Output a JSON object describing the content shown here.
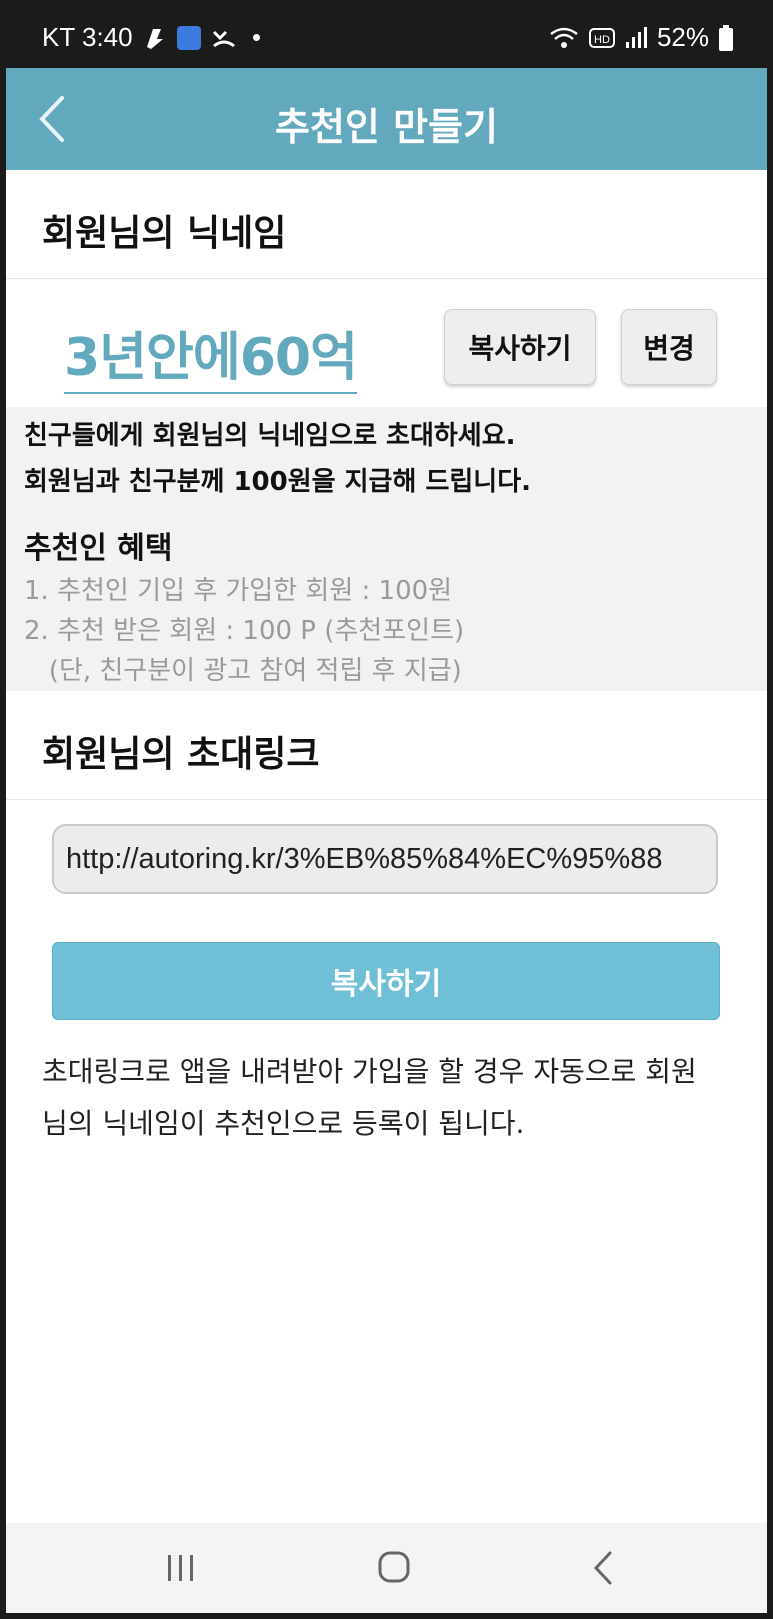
{
  "status_bar": {
    "carrier_time": "KT 3:40",
    "battery": "52%",
    "icons": [
      "notification-icon",
      "app-icon",
      "missed-call-icon",
      "wifi-icon",
      "hd-icon",
      "signal-icon",
      "battery-icon"
    ]
  },
  "app_bar": {
    "title": "추천인 만들기",
    "back_icon": "back-arrow-icon",
    "color": "#63a9bd"
  },
  "nickname_section": {
    "header": "회원님의 닉네임",
    "nickname": "3년안에60억",
    "copy_label": "복사하기",
    "change_label": "변경"
  },
  "info": {
    "line1": "친구들에게 회원님의 닉네임으로 초대하세요.",
    "line2": "회원님과 친구분께 100원을 지급해 드립니다.",
    "benefit_title": "추천인 혜택",
    "benefits": [
      "1. 추천인 기입 후 가입한 회원 : 100원",
      "2. 추천 받은 회원 : 100 P (추천포인트)",
      "   (단, 친구분이 광고 참여 적립 후 지급)"
    ]
  },
  "invite_section": {
    "header": "회원님의 초대링크",
    "link": "http://autoring.kr/3%EB%85%84%EC%95%88",
    "copy_label": "복사하기",
    "description": "초대링크로 앱을 내려받아 가입을 할 경우 자동으로 회원님의 닉네임이 추천인으로 등록이 됩니다.",
    "button_color": "#6fc0d6"
  },
  "nav_bar": {
    "icons": [
      "recents-icon",
      "home-icon",
      "back-icon"
    ]
  }
}
